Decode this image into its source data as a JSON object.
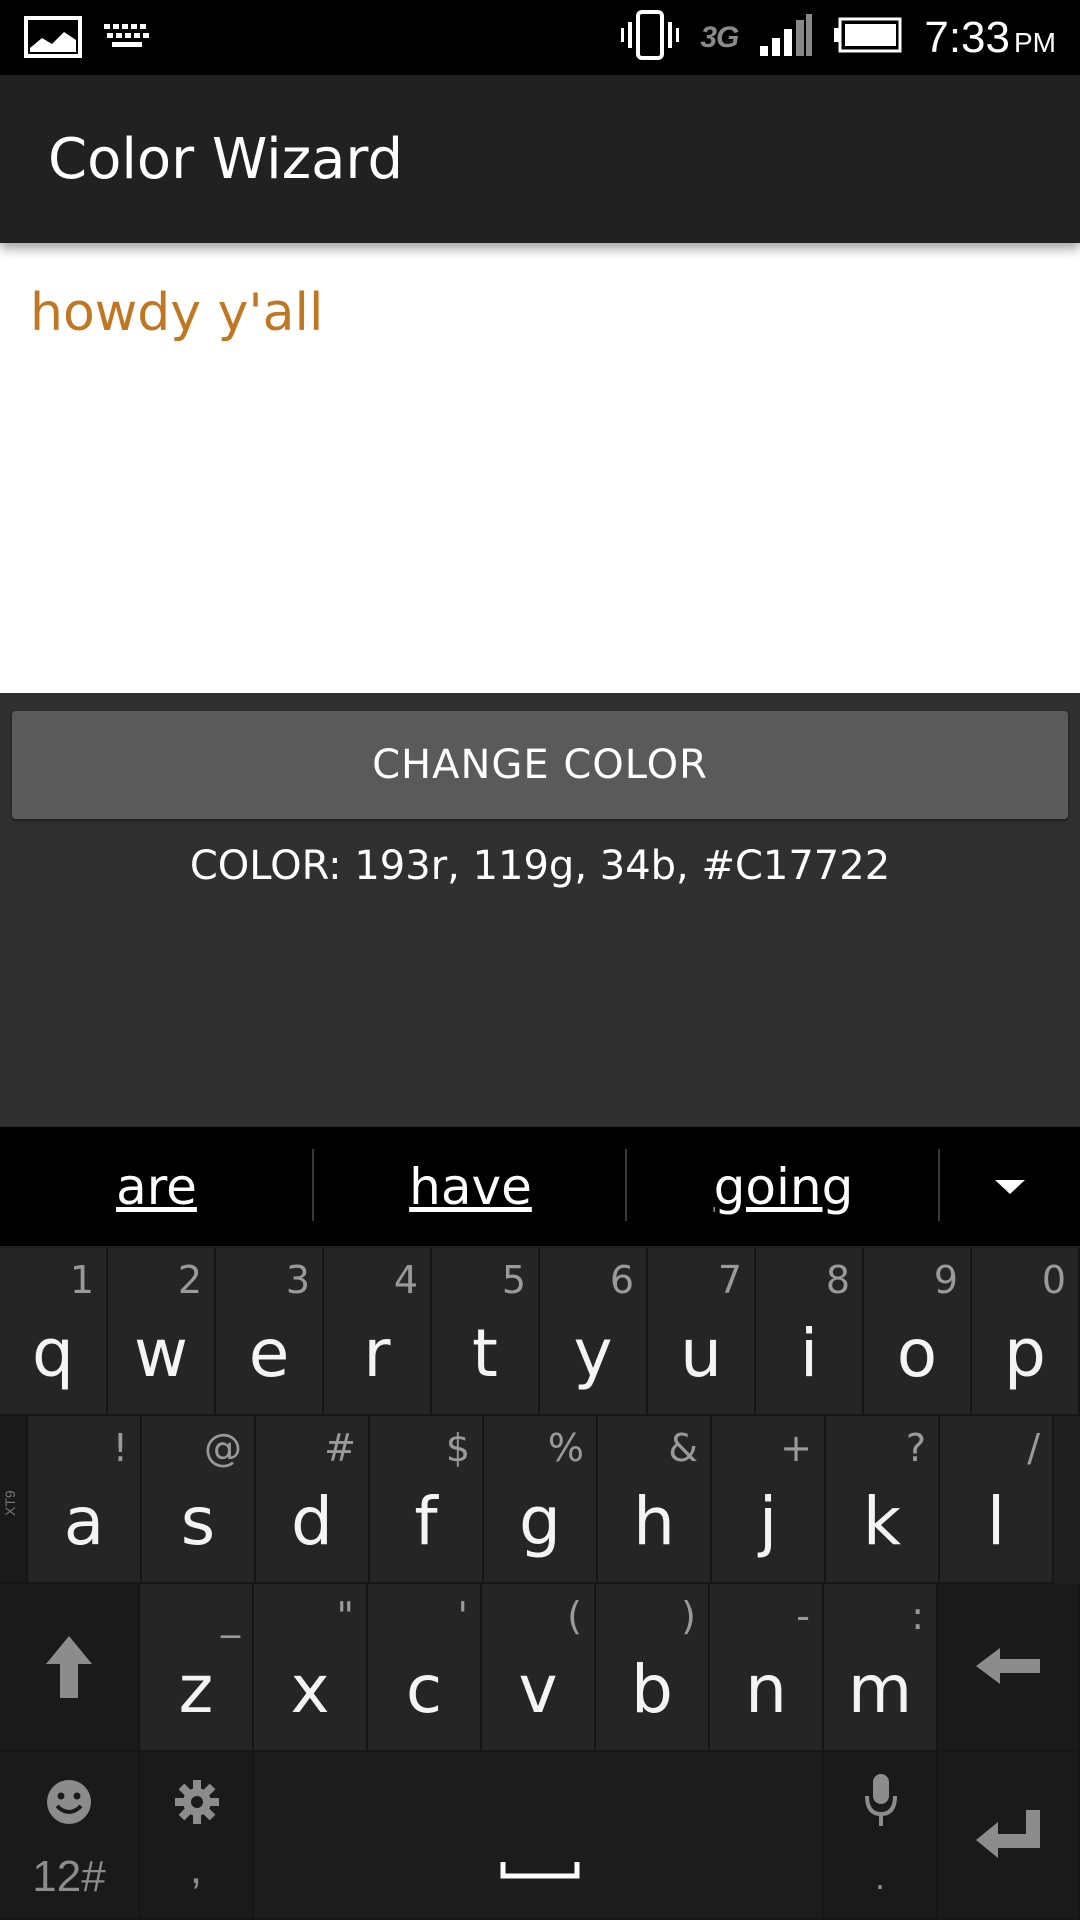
{
  "status_bar": {
    "network": "3G",
    "time": "7:33",
    "ampm": "PM",
    "icons": [
      "gallery-icon",
      "keyboard-icon",
      "vibrate-icon",
      "signal-icon",
      "battery-icon"
    ]
  },
  "app_bar": {
    "title": "Color Wizard"
  },
  "content": {
    "sample_text": "howdy y'all",
    "sample_color": "#C17722",
    "change_button_label": "CHANGE COLOR",
    "color_readout": "COLOR: 193r, 119g, 34b, #C17722"
  },
  "keyboard": {
    "suggestions": [
      "are",
      "have",
      "going"
    ],
    "row1": [
      {
        "key": "q",
        "hint": "1"
      },
      {
        "key": "w",
        "hint": "2"
      },
      {
        "key": "e",
        "hint": "3"
      },
      {
        "key": "r",
        "hint": "4"
      },
      {
        "key": "t",
        "hint": "5"
      },
      {
        "key": "y",
        "hint": "6"
      },
      {
        "key": "u",
        "hint": "7"
      },
      {
        "key": "i",
        "hint": "8"
      },
      {
        "key": "o",
        "hint": "9"
      },
      {
        "key": "p",
        "hint": "0"
      }
    ],
    "row2": [
      {
        "key": "a",
        "hint": "!"
      },
      {
        "key": "s",
        "hint": "@"
      },
      {
        "key": "d",
        "hint": "#"
      },
      {
        "key": "f",
        "hint": "$"
      },
      {
        "key": "g",
        "hint": "%"
      },
      {
        "key": "h",
        "hint": "&"
      },
      {
        "key": "j",
        "hint": "+"
      },
      {
        "key": "k",
        "hint": "?"
      },
      {
        "key": "l",
        "hint": "/"
      }
    ],
    "row3": [
      {
        "key": "z",
        "hint": "_"
      },
      {
        "key": "x",
        "hint": "\""
      },
      {
        "key": "c",
        "hint": "'"
      },
      {
        "key": "v",
        "hint": "("
      },
      {
        "key": "b",
        "hint": ")"
      },
      {
        "key": "n",
        "hint": "-"
      },
      {
        "key": "m",
        "hint": ":"
      }
    ],
    "xt9_label": "XT9",
    "symbols_label": "12#",
    "comma_label": ",",
    "period_label": "."
  }
}
